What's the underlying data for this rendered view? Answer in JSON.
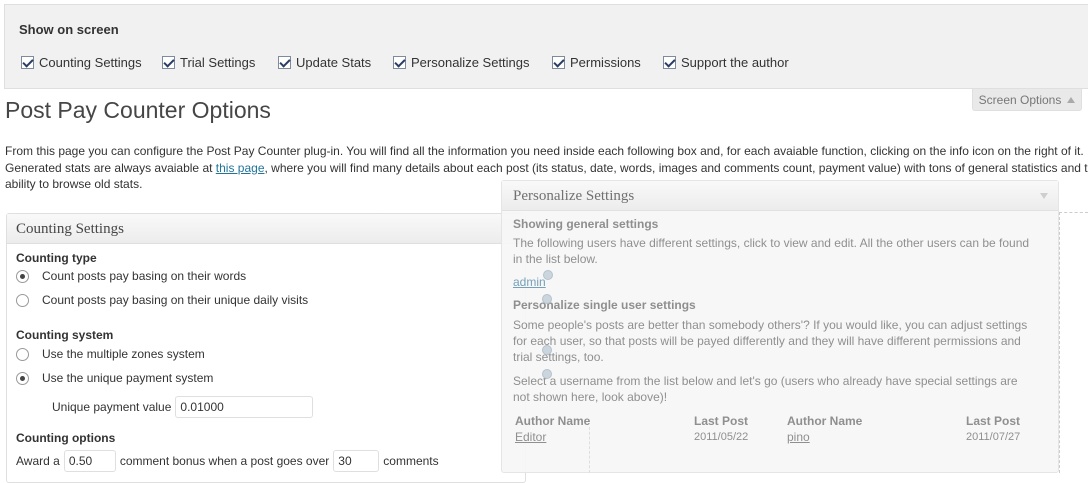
{
  "screen_options": {
    "title": "Show on screen",
    "checkboxes": [
      {
        "label": "Counting Settings",
        "checked": true
      },
      {
        "label": "Trial Settings",
        "checked": true
      },
      {
        "label": "Update Stats",
        "checked": true
      },
      {
        "label": "Personalize Settings",
        "checked": true
      },
      {
        "label": "Permissions",
        "checked": true
      },
      {
        "label": "Support the author",
        "checked": true
      }
    ],
    "tab_label": "Screen Options"
  },
  "page": {
    "title": "Post Pay Counter Options",
    "intro_line1": "From this page you can configure the Post Pay Counter plug-in. You will find all the information you need inside each following box and, for each avaiable function, clicking on the info icon on the right of it.",
    "intro_line2_before": "Generated stats are always avaiable at ",
    "intro_link": "this page",
    "intro_line2_after": ", where you will find many details about each post (its status, date, words, images and comments count, payment value) with tons of general statistics and the",
    "intro_line3": "ability to browse old stats."
  },
  "counting": {
    "header": "Counting Settings",
    "type_title": "Counting type",
    "type_options": [
      {
        "label": "Count posts pay basing on their words",
        "checked": true
      },
      {
        "label": "Count posts pay basing on their unique daily visits",
        "checked": false
      }
    ],
    "system_title": "Counting system",
    "system_options": [
      {
        "label": "Use the multiple zones system",
        "checked": false
      },
      {
        "label": "Use the unique payment system",
        "checked": true
      }
    ],
    "unique_payment_label": "Unique payment value",
    "unique_payment_value": "0.01000",
    "options_title": "Counting options",
    "award_prefix": "Award a",
    "award_value": "0.50",
    "award_middle": "comment bonus when a post goes over",
    "award_threshold": "30",
    "award_suffix": "comments"
  },
  "personalize": {
    "header": "Personalize Settings",
    "general_title": "Showing general settings",
    "general_text_1": "The following users have different settings, click to view and edit. All the other users can be found",
    "general_text_2": "in the list below.",
    "admin_link": "admin",
    "single_title": "Personalize single user settings",
    "single_text_1": "Some people's posts are better than somebody others'? If you would like, you can adjust settings",
    "single_text_2": "for each user, so that posts will be payed differently and they will have different permissions and",
    "single_text_3": "trial settings, too.",
    "select_text_1": "Select a username from the list below and let's go (users who already have special settings are",
    "select_text_2": "not shown here, look above)!",
    "table": {
      "col_author_1": "Author Name",
      "col_last_post_1": "Last Post",
      "col_author_2": "Author Name",
      "col_last_post_2": "Last Post",
      "rows": [
        {
          "author_1": "Editor",
          "last_post_1": "2011/05/22",
          "author_2": "pino",
          "last_post_2": "2011/07/27"
        }
      ]
    }
  }
}
